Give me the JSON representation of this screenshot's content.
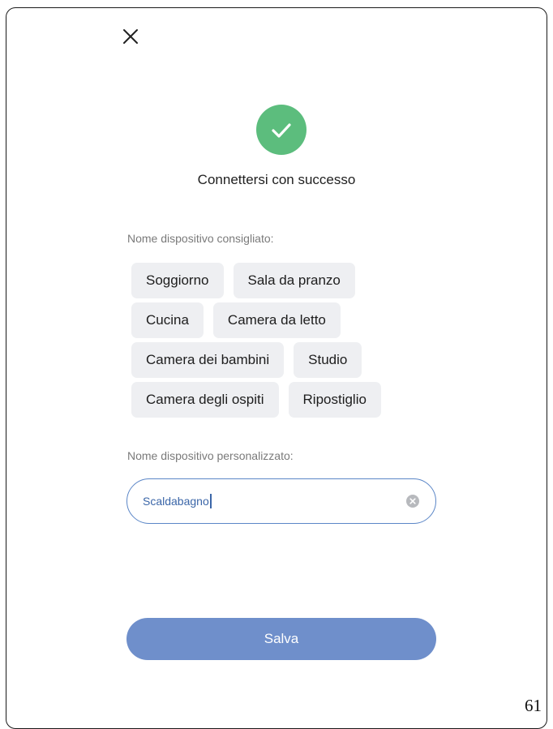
{
  "header": {
    "title": "Connettersi con successo"
  },
  "icons": {
    "close": "close-icon",
    "success": "check-icon",
    "clear": "clear-icon"
  },
  "colors": {
    "success": "#5cbd7d",
    "accent": "#5b86c7",
    "button": "#6f8fcb",
    "chip_bg": "#eeeff2"
  },
  "suggested": {
    "label": "Nome dispositivo consigliato:",
    "rows": [
      [
        "Soggiorno",
        "Sala da pranzo"
      ],
      [
        "Cucina",
        "Camera da letto"
      ],
      [
        "Camera dei bambini",
        "Studio"
      ],
      [
        "Camera degli ospiti",
        "Ripostiglio"
      ]
    ]
  },
  "custom": {
    "label": "Nome dispositivo personalizzato:",
    "value": "Scaldabagno"
  },
  "save_button": {
    "label": "Salva"
  },
  "page_number": "61"
}
